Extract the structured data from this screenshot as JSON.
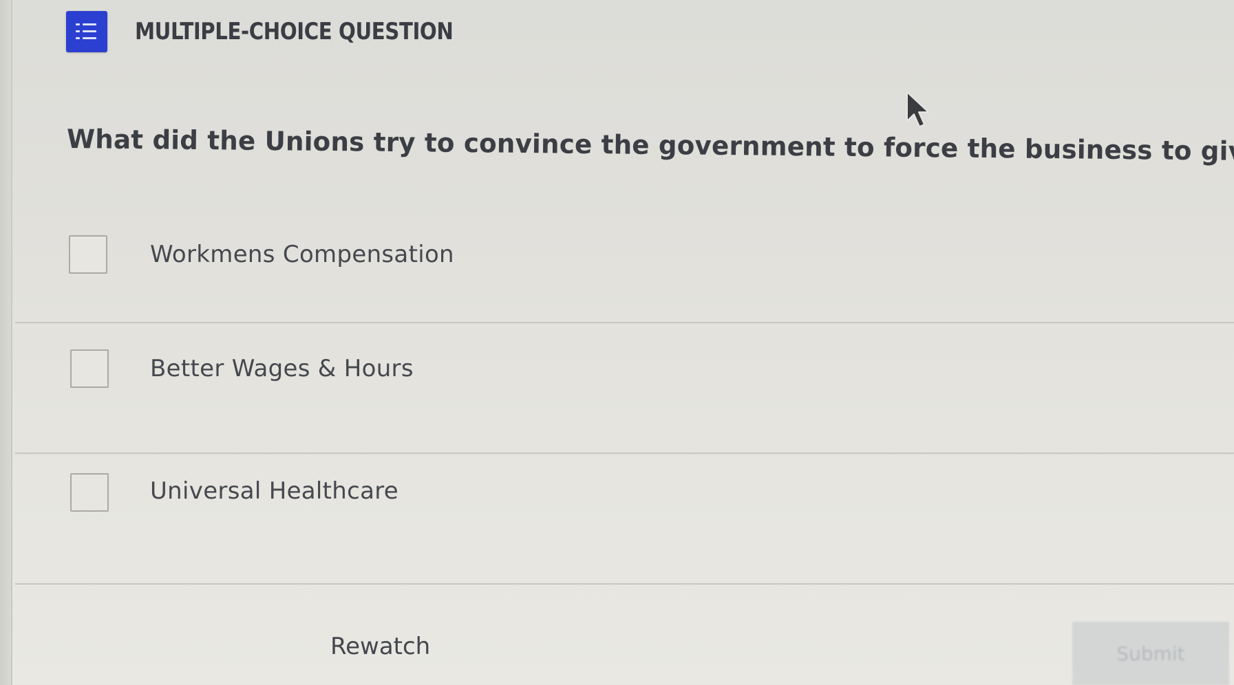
{
  "header": {
    "icon": "list-icon",
    "title": "MULTIPLE-CHOICE QUESTION",
    "accent_color": "#2b3fd0"
  },
  "question": {
    "text": "What did the Unions try to convince the government to force the business to give"
  },
  "options": [
    {
      "label": "Workmens Compensation",
      "checked": false
    },
    {
      "label": "Better Wages & Hours",
      "checked": false
    },
    {
      "label": "Universal Healthcare",
      "checked": false
    }
  ],
  "footer": {
    "rewatch_label": "Rewatch",
    "submit_label": "Submit",
    "submit_disabled": true
  },
  "cursor": {
    "icon": "mouse-pointer-icon"
  }
}
